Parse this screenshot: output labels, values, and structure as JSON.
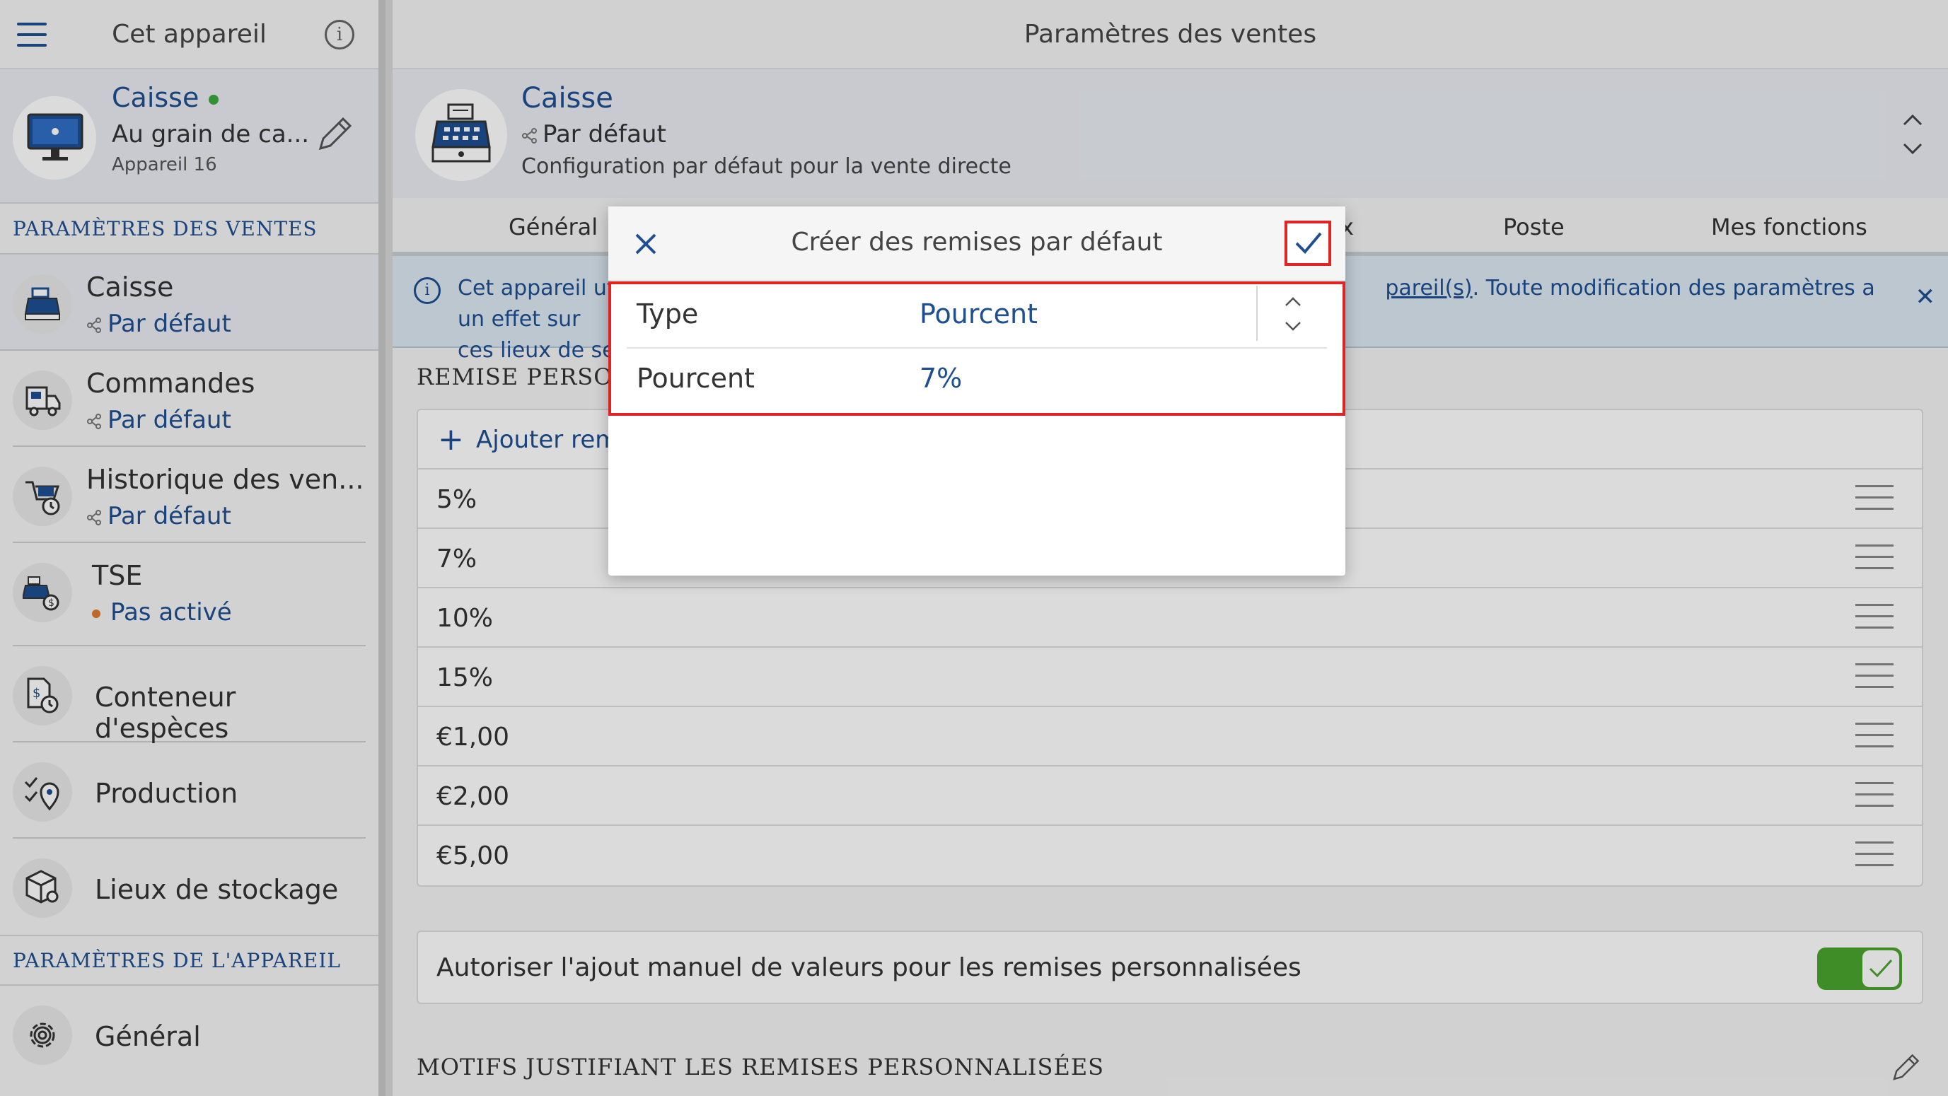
{
  "sidebar": {
    "header_title": "Cet appareil",
    "device": {
      "name": "Caisse",
      "status_color": "#3aa83a",
      "location": "Au grain de ca...",
      "id_label": "Appareil 16"
    },
    "section_sales": "PARAMÈTRES DES VENTES",
    "items": [
      {
        "label": "Caisse",
        "sub": "Par défaut"
      },
      {
        "label": "Commandes",
        "sub": "Par défaut"
      },
      {
        "label": "Historique des ven...",
        "sub": "Par défaut"
      },
      {
        "label": "TSE",
        "sub": "Pas activé"
      },
      {
        "label": "Conteneur d'espèces"
      },
      {
        "label": "Production"
      },
      {
        "label": "Lieux de stockage"
      }
    ],
    "section_device": "PARAMÈTRES DE L'APPAREIL",
    "device_items": [
      {
        "label": "Général"
      }
    ]
  },
  "main": {
    "header_title": "Paramètres des ventes",
    "profile": {
      "title": "Caisse",
      "subtitle": "Par défaut",
      "description": "Configuration par défaut pour la vente directe"
    },
    "tabs": [
      {
        "label": "Général"
      },
      {
        "label": "x"
      },
      {
        "label": "Poste"
      },
      {
        "label": "Mes fonctions"
      }
    ],
    "banner": {
      "text_start": "Cet appareil util",
      "text_link": "pareil(s)",
      "text_end": ". Toute modification des paramètres a un effet sur",
      "text_line2": "ces lieux de serv"
    },
    "section_custom": "REMISE PERSONN",
    "add_label": "Ajouter remi",
    "discounts": [
      "5%",
      "7%",
      "10%",
      "15%",
      "€1,00",
      "€2,00",
      "€5,00"
    ],
    "toggle_label": "Autoriser l'ajout manuel de valeurs pour les remises personnalisées",
    "toggle_on": true,
    "section_reasons": "MOTIFS JUSTIFIANT LES REMISES PERSONNALISÉES"
  },
  "dialog": {
    "title": "Créer des remises par défaut",
    "fields": [
      {
        "label": "Type",
        "value": "Pourcent"
      },
      {
        "label": "Pourcent",
        "value": "7%"
      }
    ]
  },
  "colors": {
    "accent": "#1e4f91",
    "highlight": "#e02424",
    "toggle": "#4aa52e",
    "warning_dot": "#e07a2e"
  }
}
